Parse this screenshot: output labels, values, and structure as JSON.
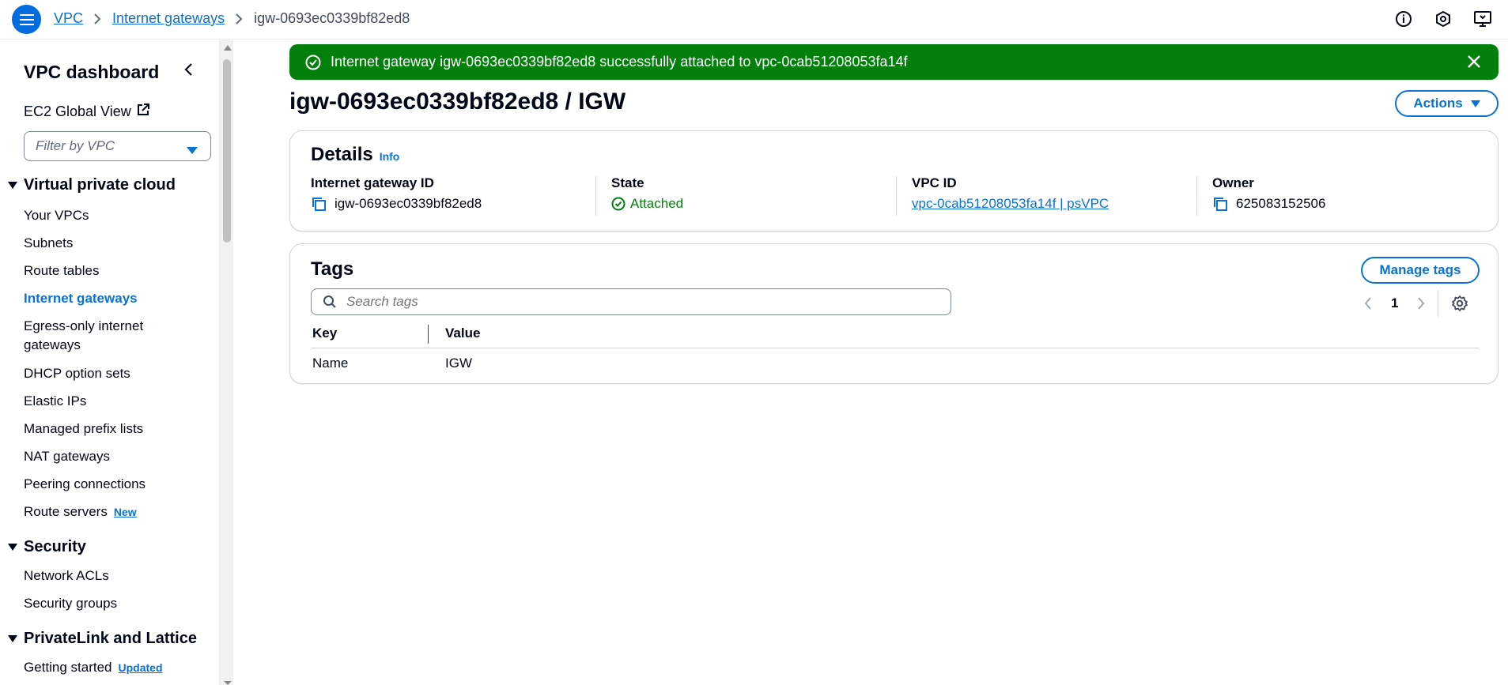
{
  "header": {
    "breadcrumb": [
      "VPC",
      "Internet gateways",
      "igw-0693ec0339bf82ed8"
    ]
  },
  "sidebar": {
    "title": "VPC dashboard",
    "ec2_global_view": "EC2 Global View",
    "filter_placeholder": "Filter by VPC",
    "sections": [
      {
        "label": "Virtual private cloud",
        "items": [
          {
            "label": "Your VPCs"
          },
          {
            "label": "Subnets"
          },
          {
            "label": "Route tables"
          },
          {
            "label": "Internet gateways",
            "active": true
          },
          {
            "label": "Egress-only internet gateways"
          },
          {
            "label": "DHCP option sets"
          },
          {
            "label": "Elastic IPs"
          },
          {
            "label": "Managed prefix lists"
          },
          {
            "label": "NAT gateways"
          },
          {
            "label": "Peering connections"
          },
          {
            "label": "Route servers",
            "badge": "New"
          }
        ]
      },
      {
        "label": "Security",
        "items": [
          {
            "label": "Network ACLs"
          },
          {
            "label": "Security groups"
          }
        ]
      },
      {
        "label": "PrivateLink and Lattice",
        "items": [
          {
            "label": "Getting started",
            "badge": "Updated"
          }
        ]
      }
    ]
  },
  "flash": {
    "message": "Internet gateway igw-0693ec0339bf82ed8 successfully attached to vpc-0cab51208053fa14f",
    "color": "#037f0c"
  },
  "page": {
    "title": "igw-0693ec0339bf82ed8 / IGW",
    "actions_label": "Actions"
  },
  "details": {
    "heading": "Details",
    "info": "Info",
    "fields": {
      "igw_id_label": "Internet gateway ID",
      "igw_id_value": "igw-0693ec0339bf82ed8",
      "state_label": "State",
      "state_value": "Attached",
      "vpc_label": "VPC ID",
      "vpc_value": "vpc-0cab51208053fa14f | psVPC",
      "owner_label": "Owner",
      "owner_value": "625083152506"
    }
  },
  "tags": {
    "heading": "Tags",
    "manage_label": "Manage tags",
    "search_placeholder": "Search tags",
    "page_number": "1",
    "columns": [
      "Key",
      "Value"
    ],
    "rows": [
      {
        "key": "Name",
        "value": "IGW"
      }
    ]
  },
  "colors": {
    "accent": "#0972d3",
    "success": "#037f0c"
  }
}
